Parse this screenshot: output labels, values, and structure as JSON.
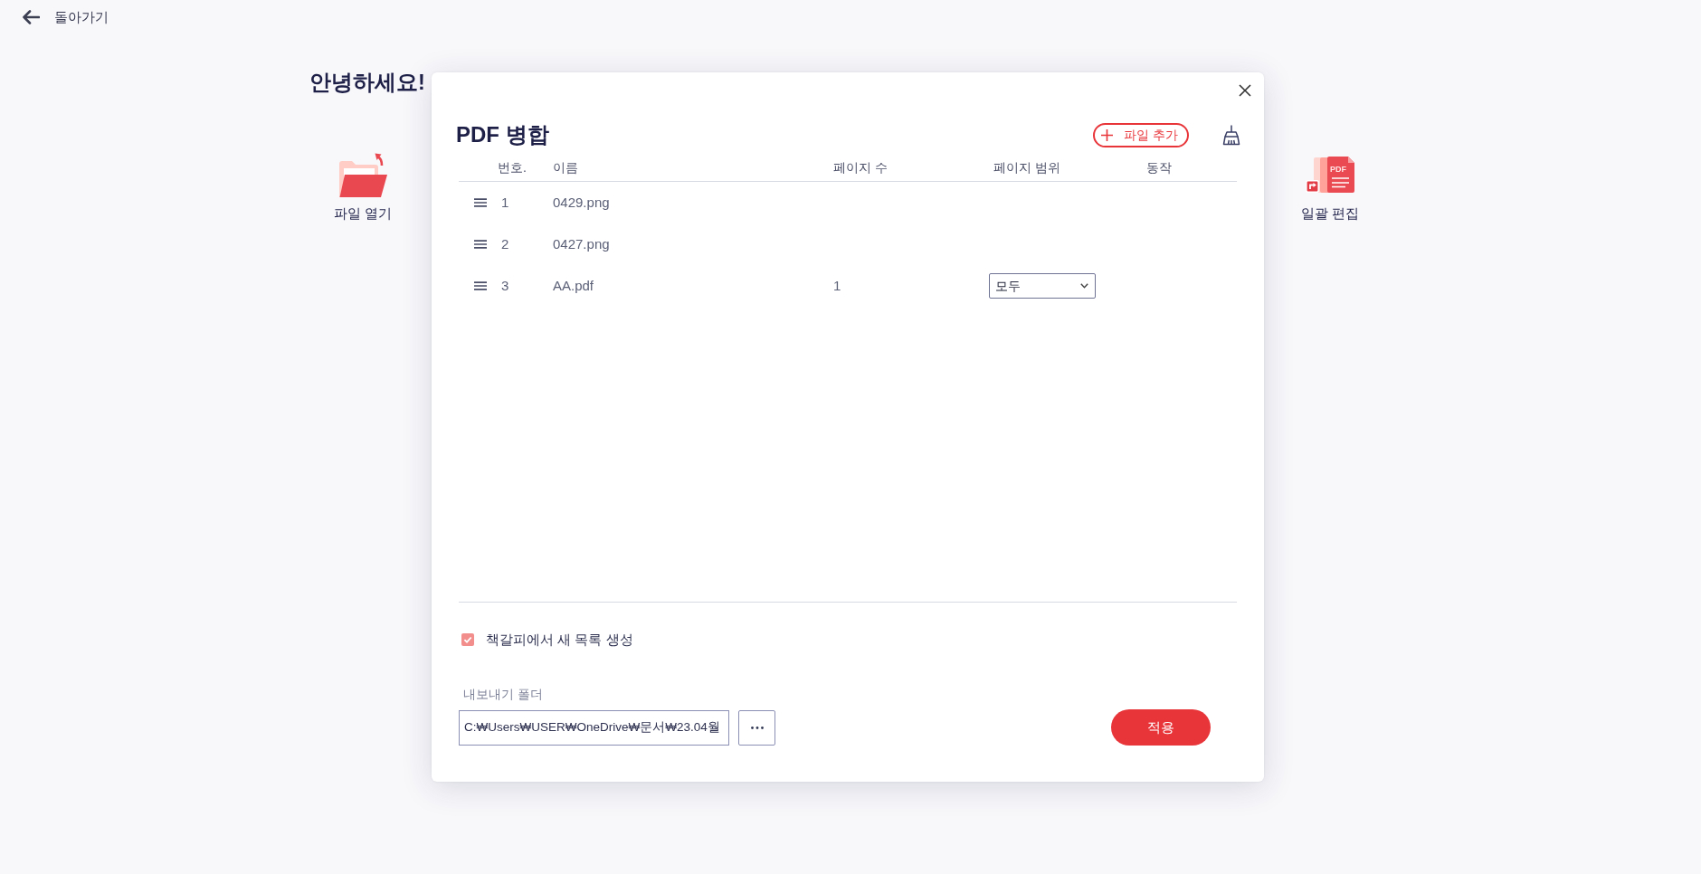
{
  "back_button": {
    "label": "돌아가기"
  },
  "home": {
    "greeting": "안녕하세요!",
    "actions": [
      {
        "kind": "folder",
        "label": "파일 열기"
      },
      {
        "kind": "pdf",
        "label": "일괄 편집",
        "icon_text": "PDF"
      }
    ]
  },
  "dialog": {
    "title": "PDF 병합",
    "add_button": {
      "label": "파일 추가"
    },
    "table": {
      "columns": [
        "번호.",
        "이름",
        "페이지 수",
        "페이지 범위",
        "동작"
      ],
      "rows": [
        {
          "number": "1",
          "name": "0429.png"
        },
        {
          "number": "2",
          "name": "0427.png"
        },
        {
          "number": "3",
          "name": "AA.pdf",
          "page_count": "1",
          "page_range": "모두"
        }
      ]
    },
    "bookmark_option": {
      "label": "책갈피에서 새 목록 생성",
      "checked": true
    },
    "export_folder": {
      "label": "내보내기 폴더",
      "value": "C:₩Users₩USER₩OneDrive₩문서₩23.04월"
    },
    "apply_button": {
      "label": "적용"
    }
  }
}
